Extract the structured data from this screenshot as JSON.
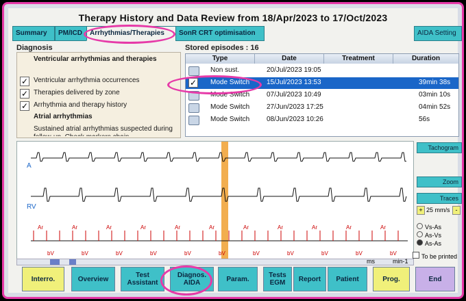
{
  "window_title": "Therapy History and Data Review from 18/Apr/2023 to 17/Oct/2023",
  "tabs": [
    "Summary",
    "PM/ICD",
    "Arrhythmias/Therapies",
    "SonR CRT optimisation"
  ],
  "aida_tab": "AIDA Setting",
  "diagnosis": {
    "label": "Diagnosis",
    "heading1": "Ventricular arrhythmias and therapies",
    "items": [
      {
        "text": "Ventricular arrhythmia occurrences",
        "checked": true
      },
      {
        "text": "Therapies delivered by zone",
        "checked": true
      },
      {
        "text": "Arrhythmia and therapy history",
        "checked": true
      }
    ],
    "heading2": "Atrial arrhythmias",
    "desc": "Sustained atrial arrhythmias suspected during follow-up. Check markers chain"
  },
  "stored": {
    "label": "Stored episodes : 16",
    "columns": [
      "Type",
      "Date",
      "Treatment",
      "Duration"
    ],
    "rows": [
      {
        "type": "Non sust.",
        "date": "20/Jul/2023 19:05",
        "treatment": "",
        "duration": "",
        "selected": false
      },
      {
        "type": "Mode Switch",
        "date": "15/Jul/2023 13:53",
        "treatment": "",
        "duration": "39min 38s",
        "selected": true
      },
      {
        "type": "Mode Switch",
        "date": "07/Jul/2023 10:49",
        "treatment": "",
        "duration": "03min 10s",
        "selected": false
      },
      {
        "type": "Mode Switch",
        "date": "27/Jun/2023 17:25",
        "treatment": "",
        "duration": "04min 52s",
        "selected": false
      },
      {
        "type": "Mode Switch",
        "date": "08/Jun/2023 10:26",
        "treatment": "",
        "duration": "56s",
        "selected": false
      }
    ]
  },
  "ecg": {
    "channel_a": "A",
    "channel_rv": "RV",
    "marker_ar": "Ar",
    "marker_bv": "bV",
    "speed": "25 mm/s",
    "unit_ms": "ms",
    "unit_min": "min-1",
    "print_label": "To be printed",
    "radio_options": [
      "Vs-As",
      "As-Vs",
      "As-As"
    ],
    "selected_radio": 2
  },
  "side_buttons": [
    "Tachogram",
    "Zoom",
    "Traces"
  ],
  "bottom_buttons": [
    {
      "label": "Interro.",
      "color": "#f0f07a"
    },
    {
      "label": "Overview",
      "color": "#3fc0c8"
    },
    {
      "label": "Test Assistant",
      "color": "#3fc0c8"
    },
    {
      "label": "Diagnos. AIDA",
      "color": "#3fc0c8"
    },
    {
      "label": "Param.",
      "color": "#3fc0c8"
    },
    {
      "label": "Tests EGM",
      "color": "#3fc0c8"
    },
    {
      "label": "Report",
      "color": "#3fc0c8"
    },
    {
      "label": "Patient",
      "color": "#3fc0c8"
    },
    {
      "label": "Prog.",
      "color": "#f0f07a"
    },
    {
      "label": "End",
      "color": "#c8b0e8"
    }
  ],
  "colors": {
    "accent": "#3fc0c8",
    "highlight": "#e63aa8",
    "selected_row": "#1a66c8",
    "cursor": "#f0a030"
  }
}
